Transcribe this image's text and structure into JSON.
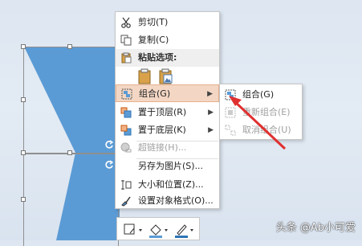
{
  "context_menu": {
    "cut": "剪切(T)",
    "copy": "复制(C)",
    "paste_options": "粘贴选项:",
    "group": "组合(G)",
    "bring_to_front": "置于顶层(R)",
    "send_to_back": "置于底层(K)",
    "hyperlink": "超链接(H)...",
    "save_as_picture": "另存为图片(S)...",
    "size_position": "大小和位置(Z)...",
    "format_object": "设置对象格式(O)..."
  },
  "submenu": {
    "group": "组合(G)",
    "regroup": "重新组合(E)",
    "ungroup": "取消组合(U)"
  },
  "watermark": "头条 @Ab小可爱",
  "colors": {
    "shape_fill": "#5b9bd5",
    "highlight": "#f3d7c4",
    "arrow": "#e03030"
  }
}
